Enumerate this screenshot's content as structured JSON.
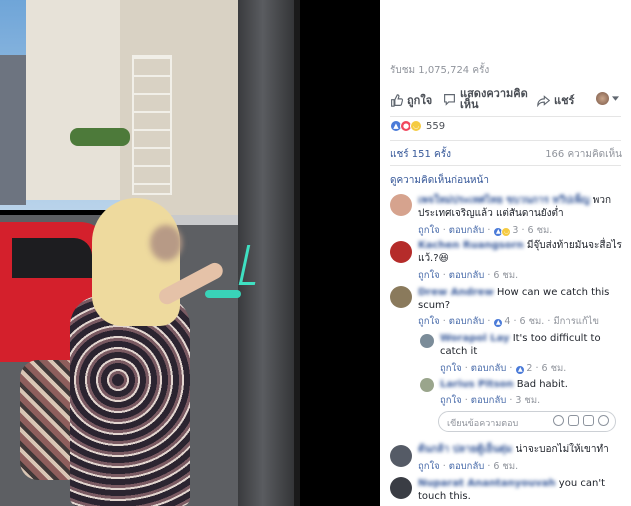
{
  "stats": {
    "views": "รับชม 1,075,724 ครั้ง",
    "reaction_count": "559",
    "shares": "แชร์ 151 ครั้ง",
    "comments": "166 ความคิดเห็น"
  },
  "actions": {
    "like": "ถูกใจ",
    "comment": "แสดงความคิดเห็น",
    "share": "แชร์"
  },
  "view_previous": "ดูความคิดเห็นก่อนหน้า",
  "comments": [
    {
      "author": "เพจใหม่ประเทศไทย ขบวนการ ทวีปเพ็ญ",
      "text": "พวกประเทศเจริญแล้ว แต่สันดานยังต่ำ",
      "like": "ถูกใจ",
      "reply": "ตอบกลับ",
      "reactions": "3",
      "time": "6 ชม.",
      "avatar_color": "#d6a38e"
    },
    {
      "author": "Kachen Ruangsorn",
      "text": "มีจุ๊บส่งท้ายมันจะสื่อไรแว้.?😆",
      "like": "ถูกใจ",
      "reply": "ตอบกลับ",
      "reactions": "",
      "time": "6 ชม.",
      "avatar_color": "#b52c2a"
    },
    {
      "author": "Drew Andrew",
      "text": "How can we catch this scum?",
      "like": "ถูกใจ",
      "reply": "ตอบกลับ",
      "reactions": "4",
      "time": "6 ชม.",
      "extra": "มีการแก้ไข",
      "avatar_color": "#8a7a5c"
    },
    {
      "author": "Worapol Lay",
      "text": "It's too difficult to catch it",
      "like": "ถูกใจ",
      "reply": "ตอบกลับ",
      "reactions": "2",
      "time": "6 ชม.",
      "avatar_color": "#7b8c99"
    },
    {
      "author": "Larius Pitson",
      "text": "Bad habit.",
      "like": "ถูกใจ",
      "reply": "ตอบกลับ",
      "reactions": "",
      "time": "3 ชม.",
      "avatar_color": "#9aa58c"
    },
    {
      "author": "ต้นกล้า ปลายตู้เย็นตุ่ม",
      "text": "น่าจะบอกไม่ให้เขาทำ",
      "like": "ถูกใจ",
      "reply": "ตอบกลับ",
      "reactions": "",
      "time": "6 ชม.",
      "avatar_color": "#555b66"
    },
    {
      "author": "Nuparat Anantanyouvah",
      "text": "you can't touch this.",
      "avatar_color": "#3a3d44"
    }
  ],
  "reply_placeholder": "เขียนข้อความตอบ"
}
